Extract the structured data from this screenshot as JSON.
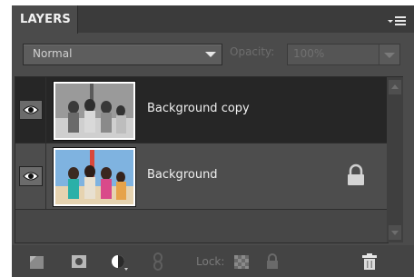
{
  "panel": {
    "tab_label": "LAYERS"
  },
  "blend_mode": {
    "value": "Normal"
  },
  "opacity": {
    "label": "Opacity:",
    "value": "100%"
  },
  "layers": [
    {
      "name": "Background copy",
      "selected": true,
      "visible": true,
      "locked": false
    },
    {
      "name": "Background",
      "selected": false,
      "visible": true,
      "locked": true
    }
  ],
  "bottom_toolbar": {
    "lock_label": "Lock:"
  },
  "icons": [
    "panel-menu-icon",
    "eye-icon",
    "lock-icon",
    "new-layer-icon",
    "mask-icon",
    "adjustment-layer-icon",
    "link-icon",
    "lock-transparent-icon",
    "lock-all-icon",
    "trash-icon",
    "scroll-up-icon",
    "scroll-down-icon"
  ],
  "colors": {
    "panel_bg": "#4b4b4b",
    "selected_row": "#262626",
    "text": "#f0f0f0"
  }
}
